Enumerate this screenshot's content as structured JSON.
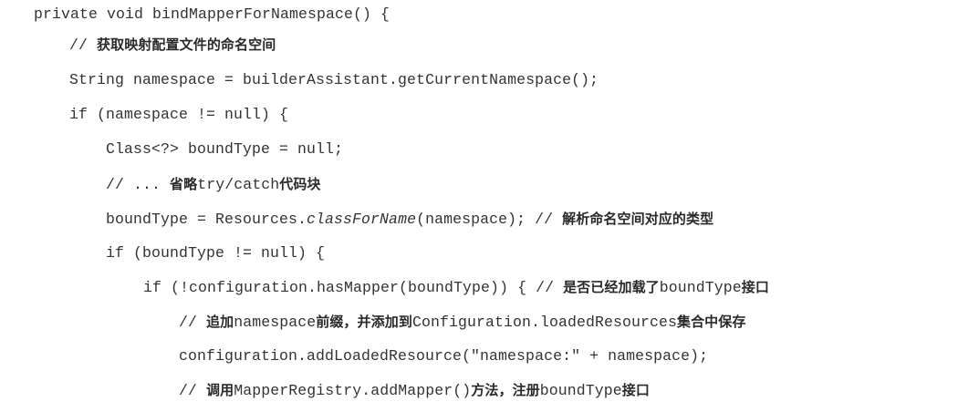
{
  "code": {
    "lines": [
      {
        "segments": [
          {
            "t": "private void bindMapperForNamespace() {"
          }
        ]
      },
      {
        "segments": [
          {
            "t": "// "
          },
          {
            "t": "获取映射配置文件的命名空间",
            "zh": true
          }
        ]
      },
      {
        "segments": [
          {
            "t": "String namespace = builderAssistant.getCurrentNamespace();"
          }
        ]
      },
      {
        "segments": [
          {
            "t": "if (namespace != null) {"
          }
        ]
      },
      {
        "segments": [
          {
            "t": "Class<?> boundType = null;"
          }
        ]
      },
      {
        "segments": [
          {
            "t": "// ... "
          },
          {
            "t": "省略",
            "zh": true
          },
          {
            "t": "try/catch"
          },
          {
            "t": "代码块",
            "zh": true
          }
        ]
      },
      {
        "segments": [
          {
            "t": "boundType = Resources."
          },
          {
            "t": "classForName",
            "italic": true
          },
          {
            "t": "(namespace); // "
          },
          {
            "t": "解析命名空间对应的类型",
            "zh": true
          }
        ]
      },
      {
        "segments": [
          {
            "t": "if (boundType != null) {"
          }
        ]
      },
      {
        "segments": [
          {
            "t": "if (!configuration.hasMapper(boundType)) { // "
          },
          {
            "t": "是否已经加载了",
            "zh": true
          },
          {
            "t": "boundType"
          },
          {
            "t": "接口",
            "zh": true
          }
        ]
      },
      {
        "segments": [
          {
            "t": "// "
          },
          {
            "t": "追加",
            "zh": true
          },
          {
            "t": "namespace"
          },
          {
            "t": "前缀，并添加到",
            "zh": true
          },
          {
            "t": "Configuration.loadedResources"
          },
          {
            "t": "集合中保存",
            "zh": true
          }
        ]
      },
      {
        "segments": [
          {
            "t": "configuration.addLoadedResource(\"namespace:\" + namespace);"
          }
        ]
      },
      {
        "segments": [
          {
            "t": "// "
          },
          {
            "t": "调用",
            "zh": true
          },
          {
            "t": "MapperRegistry.addMapper()"
          },
          {
            "t": "方法，注册",
            "zh": true
          },
          {
            "t": "boundType"
          },
          {
            "t": "接口",
            "zh": true
          }
        ]
      }
    ]
  }
}
